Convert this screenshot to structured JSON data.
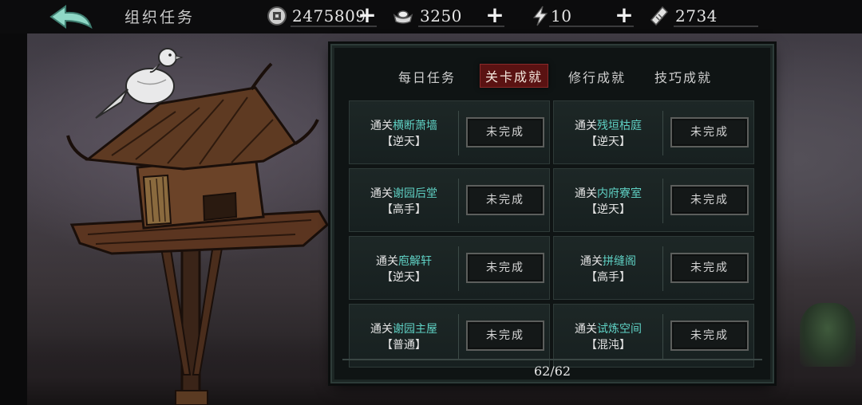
{
  "header": {
    "title": "组织任务",
    "resources": [
      {
        "icon": "coin-icon",
        "value": "2475809"
      },
      {
        "icon": "ingot-icon",
        "value": "3250"
      },
      {
        "icon": "energy-icon",
        "value": "10"
      },
      {
        "icon": "ticket-icon",
        "value": "2734"
      }
    ],
    "plus_label": "+"
  },
  "tabs": [
    {
      "label": "每日任务",
      "active": false
    },
    {
      "label": "关卡成就",
      "active": true
    },
    {
      "label": "修行成就",
      "active": false
    },
    {
      "label": "技巧成就",
      "active": false
    }
  ],
  "tab_alert": "!",
  "achievements": [
    {
      "prefix": "通关",
      "stage": "横断萧墙",
      "difficulty": "【逆天】",
      "status": "未完成"
    },
    {
      "prefix": "通关",
      "stage": "残垣枯庭",
      "difficulty": "【逆天】",
      "status": "未完成"
    },
    {
      "prefix": "通关",
      "stage": "谢园后堂",
      "difficulty": "【高手】",
      "status": "未完成"
    },
    {
      "prefix": "通关",
      "stage": "内府寮室",
      "difficulty": "【逆天】",
      "status": "未完成"
    },
    {
      "prefix": "通关",
      "stage": "庖解轩",
      "difficulty": "【逆天】",
      "status": "未完成"
    },
    {
      "prefix": "通关",
      "stage": "拼缝阁",
      "difficulty": "【高手】",
      "status": "未完成"
    },
    {
      "prefix": "通关",
      "stage": "谢园主屋",
      "difficulty": "【普通】",
      "status": "未完成"
    },
    {
      "prefix": "通关",
      "stage": "试炼空间",
      "difficulty": "【混沌】",
      "status": "未完成"
    }
  ],
  "progress": "62/62",
  "colors": {
    "accent": "#5fd1c4",
    "active_tab": "#5a1212",
    "back_arrow": "#7ec9b8"
  }
}
